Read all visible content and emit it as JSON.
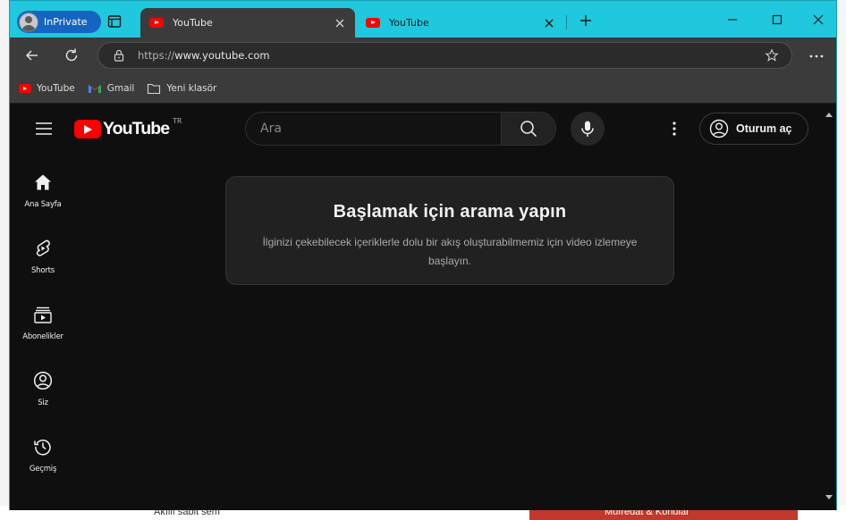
{
  "browser": {
    "profile_label": "InPrivate",
    "tabs": [
      {
        "label": "YouTube",
        "active": true
      },
      {
        "label": "YouTube",
        "active": false
      }
    ],
    "url_scheme": "https://",
    "url_host": "www.youtube.com",
    "bookmarks": [
      {
        "label": "YouTube",
        "icon": "youtube-icon"
      },
      {
        "label": "Gmail",
        "icon": "gmail-icon"
      },
      {
        "label": "Yeni klasör",
        "icon": "folder-icon"
      }
    ],
    "colors": {
      "titlebar": "#1fc8dc",
      "chrome": "#3b3b3b",
      "inprivate_pill": "#1565c0"
    }
  },
  "youtube": {
    "logo_text": "YouTube",
    "country_code": "TR",
    "search_placeholder": "Ara",
    "sign_in_label": "Oturum aç",
    "guide": [
      {
        "label": "Ana Sayfa",
        "icon": "home-icon"
      },
      {
        "label": "Shorts",
        "icon": "shorts-icon"
      },
      {
        "label": "Abonelikler",
        "icon": "subscriptions-icon"
      },
      {
        "label": "Siz",
        "icon": "you-icon"
      },
      {
        "label": "Geçmiş",
        "icon": "history-icon"
      }
    ],
    "prompt": {
      "title": "Başlamak için arama yapın",
      "message": "İlginizi çekebilecek içeriklerle dolu bir akış oluşturabilmemiz için video izlemeye başlayın."
    },
    "colors": {
      "background": "#0f0f0f",
      "brand_red": "#ff0000",
      "card": "#212121"
    }
  },
  "background_page": {
    "bottom_text": "Akıllı sabit sem",
    "red_bar_text": "Müfredat & Konular"
  }
}
